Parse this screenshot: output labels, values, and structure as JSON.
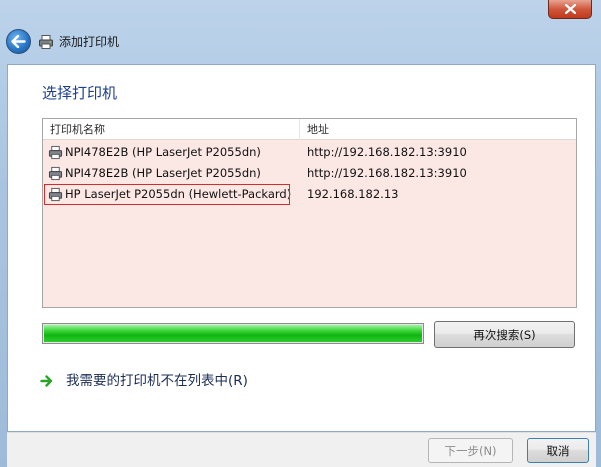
{
  "window": {
    "title": "添加打印机",
    "close_label": "×"
  },
  "page": {
    "heading": "选择打印机"
  },
  "printer_list": {
    "columns": [
      "打印机名称",
      "地址"
    ],
    "rows": [
      {
        "name": "NPI478E2B (HP LaserJet P2055dn)",
        "address": "http://192.168.182.13:3910"
      },
      {
        "name": "NPI478E2B (HP LaserJet P2055dn)",
        "address": "http://192.168.182.13:3910"
      },
      {
        "name": "HP LaserJet P2055dn (Hewlett-Packard)",
        "address": "192.168.182.13"
      }
    ],
    "highlighted_row_index": 2,
    "row_icon": "printer-icon"
  },
  "search": {
    "progress_percent": 100,
    "progress_color": "#22c422",
    "research_button_label": "再次搜索(S)"
  },
  "not_listed_link": {
    "icon": "green-arrow-icon",
    "label": "我需要的打印机不在列表中(R)"
  },
  "footer": {
    "next_button_label": "下一步(N)",
    "next_enabled": false,
    "cancel_button_label": "取消"
  },
  "colors": {
    "list_background": "#fbe7e4",
    "heading": "#1e3f8c",
    "highlight_border": "#d42b2b",
    "arrow": "#2aa52a"
  }
}
